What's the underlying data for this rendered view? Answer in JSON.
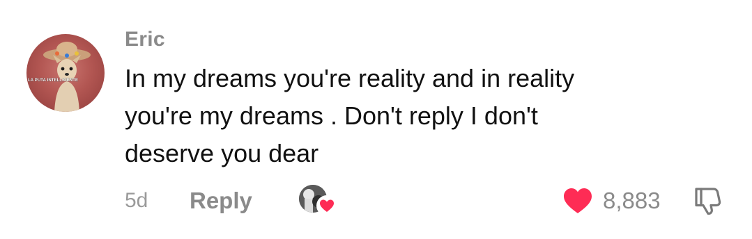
{
  "comment": {
    "username": "Eric",
    "avatar_caption": "LA PUTA INTELLIGENTE",
    "text_lines": [
      "In my dreams you're reality and in reality",
      "you're my dreams . Don't reply I don't",
      "deserve you dear"
    ],
    "timestamp": "5d",
    "reply_label": "Reply",
    "like_count": "8,883",
    "liked": true,
    "creator_liked": true
  },
  "colors": {
    "like_heart": "#fe2c55",
    "meta_text": "#8a8a8a",
    "body_text": "#111111"
  },
  "icons": {
    "like": "heart-icon",
    "dislike": "thumbs-down-icon",
    "creator_like_badge": "heart-icon"
  }
}
